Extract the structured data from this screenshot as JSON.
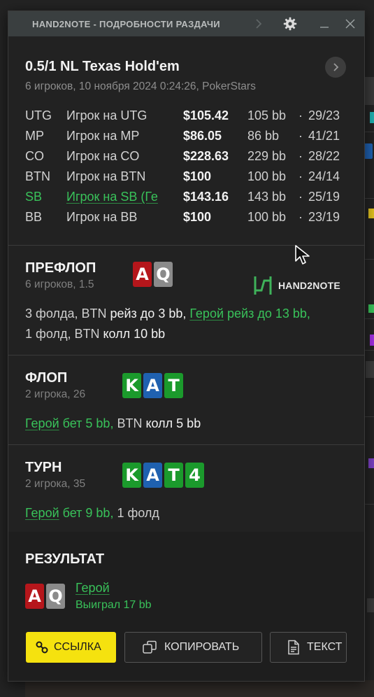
{
  "window": {
    "title": "HAND2NOTE - ПОДРОБНОСТИ РАЗДАЧИ"
  },
  "hand": {
    "game": "0.5/1 NL Texas Hold'em",
    "subtitle": "6 игроков, 10 ноября 2024 0:24:26, PokerStars"
  },
  "players": [
    {
      "pos": "UTG",
      "name": "Игрок на UTG",
      "stack": "$105.42",
      "bb": "105 bb",
      "sep": "·",
      "stats": "29/23",
      "hero": false
    },
    {
      "pos": "MP",
      "name": "Игрок на MP",
      "stack": "$86.05",
      "bb": "86 bb",
      "sep": "·",
      "stats": "41/21",
      "hero": false
    },
    {
      "pos": "CO",
      "name": "Игрок на CO",
      "stack": "$228.63",
      "bb": "229 bb",
      "sep": "·",
      "stats": "28/22",
      "hero": false
    },
    {
      "pos": "BTN",
      "name": "Игрок на BTN",
      "stack": "$100",
      "bb": "100 bb",
      "sep": "·",
      "stats": "24/14",
      "hero": false
    },
    {
      "pos": "SB",
      "name": "Игрок на SB (Ге",
      "stack": "$143.16",
      "bb": "143 bb",
      "sep": "·",
      "stats": "25/19",
      "hero": true
    },
    {
      "pos": "BB",
      "name": "Игрок на BB",
      "stack": "$100",
      "bb": "100 bb",
      "sep": "·",
      "stats": "23/19",
      "hero": false
    }
  ],
  "logo": {
    "text": "HAND2NOTE"
  },
  "preflop": {
    "label": "ПРЕФЛОП",
    "sub": "6 игроков, 1.5",
    "cards": [
      {
        "rank": "A",
        "color": "red"
      },
      {
        "rank": "Q",
        "color": "gray"
      }
    ],
    "action": {
      "p1": "3 фолда, BTN ",
      "p2": "рейз до 3 bb,",
      "p3": "Герой",
      "p4": " рейз до 13 bb,",
      "p5": "1 фолд, BTN ",
      "p6": "колл 10 bb"
    }
  },
  "flop": {
    "label": "ФЛОП",
    "sub": "2 игрока, 26",
    "cards": [
      {
        "rank": "K",
        "color": "green"
      },
      {
        "rank": "A",
        "color": "blue"
      },
      {
        "rank": "T",
        "color": "green"
      }
    ],
    "action": {
      "p1": "Герой",
      "p2": " бет 5 bb,",
      "p3": " BTN ",
      "p4": "колл 5 bb"
    }
  },
  "turn": {
    "label": "ТУРН",
    "sub": "2 игрока, 35",
    "cards": [
      {
        "rank": "K",
        "color": "green"
      },
      {
        "rank": "A",
        "color": "blue"
      },
      {
        "rank": "T",
        "color": "green"
      },
      {
        "rank": "4",
        "color": "green"
      }
    ],
    "action": {
      "p1": "Герой",
      "p2": " бет 9 bb,",
      "p3": " 1 фолд"
    }
  },
  "result": {
    "label": "РЕЗУЛЬТАТ",
    "cards": [
      {
        "rank": "A",
        "color": "red"
      },
      {
        "rank": "Q",
        "color": "gray"
      }
    ],
    "player": "Герой",
    "outcome": "Выиграл 17 bb"
  },
  "buttons": {
    "link": "ССЫЛКА",
    "copy": "КОПИРОВАТЬ",
    "text": "ТЕКСТ"
  },
  "colors": {
    "accent_green": "#39c25a",
    "link_yellow": "#f5e20f",
    "card_red": "#b5161b",
    "card_blue": "#1f61b0",
    "card_green": "#1b9a2c"
  }
}
